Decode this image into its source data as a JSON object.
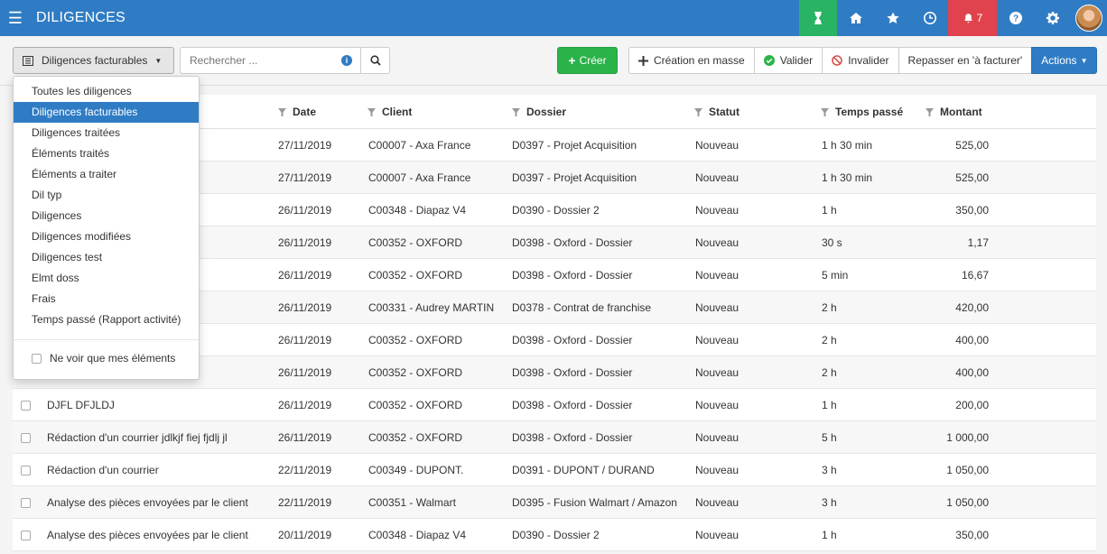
{
  "app": {
    "title": "DILIGENCES",
    "notifications_count": "7"
  },
  "toolbar": {
    "filter_label": "Diligences facturables",
    "search_placeholder": "Rechercher ...",
    "create_label": "Créer",
    "mass_create_label": "Création en masse",
    "validate_label": "Valider",
    "invalidate_label": "Invalider",
    "rebill_label": "Repasser en 'à facturer'",
    "actions_label": "Actions"
  },
  "dropdown": {
    "items": [
      "Toutes les diligences",
      "Diligences facturables",
      "Diligences traitées",
      "Éléments traités",
      "Éléments a traiter",
      "Dil typ",
      "Diligences",
      "Diligences modifiées",
      "Diligences test",
      "Elmt doss",
      "Frais",
      "Temps passé (Rapport activité)"
    ],
    "active_index": 1,
    "only_mine_label": "Ne voir que mes éléments"
  },
  "table": {
    "headers": {
      "date": "Date",
      "client": "Client",
      "dossier": "Dossier",
      "statut": "Statut",
      "temps": "Temps passé",
      "montant": "Montant"
    },
    "rows": [
      {
        "libelle": "",
        "date": "27/11/2019",
        "client": "C00007 - Axa France",
        "dossier": "D0397 - Projet Acquisition",
        "statut": "Nouveau",
        "temps": "1 h 30 min",
        "montant": "525,00"
      },
      {
        "libelle": "ar le client",
        "date": "27/11/2019",
        "client": "C00007 - Axa France",
        "dossier": "D0397 - Projet Acquisition",
        "statut": "Nouveau",
        "temps": "1 h 30 min",
        "montant": "525,00"
      },
      {
        "libelle": "",
        "date": "26/11/2019",
        "client": "C00348 - Diapaz V4",
        "dossier": "D0390 - Dossier 2",
        "statut": "Nouveau",
        "temps": "1 h",
        "montant": "350,00"
      },
      {
        "libelle": "ar le client",
        "date": "26/11/2019",
        "client": "C00352 - OXFORD",
        "dossier": "D0398 - Oxford - Dossier",
        "statut": "Nouveau",
        "temps": "30 s",
        "montant": "1,17"
      },
      {
        "libelle": "",
        "date": "26/11/2019",
        "client": "C00352 - OXFORD",
        "dossier": "D0398 - Oxford - Dossier",
        "statut": "Nouveau",
        "temps": "5 min",
        "montant": "16,67"
      },
      {
        "libelle": "ar le client",
        "date": "26/11/2019",
        "client": "C00331 - Audrey MARTIN",
        "dossier": "D0378 - Contrat de franchise",
        "statut": "Nouveau",
        "temps": "2 h",
        "montant": "420,00"
      },
      {
        "libelle": "",
        "date": "26/11/2019",
        "client": "C00352 - OXFORD",
        "dossier": "D0398 - Oxford - Dossier",
        "statut": "Nouveau",
        "temps": "2 h",
        "montant": "400,00"
      },
      {
        "libelle": "",
        "date": "26/11/2019",
        "client": "C00352 - OXFORD",
        "dossier": "D0398 - Oxford - Dossier",
        "statut": "Nouveau",
        "temps": "2 h",
        "montant": "400,00"
      },
      {
        "libelle": "DJFL DFJLDJ",
        "date": "26/11/2019",
        "client": "C00352 - OXFORD",
        "dossier": "D0398 - Oxford - Dossier",
        "statut": "Nouveau",
        "temps": "1 h",
        "montant": "200,00"
      },
      {
        "libelle": "Rédaction d'un courrier jdlkjf fiej fjdlj jl",
        "date": "26/11/2019",
        "client": "C00352 - OXFORD",
        "dossier": "D0398 - Oxford - Dossier",
        "statut": "Nouveau",
        "temps": "5 h",
        "montant": "1 000,00"
      },
      {
        "libelle": "Rédaction d'un courrier",
        "date": "22/11/2019",
        "client": "C00349 - DUPONT.",
        "dossier": "D0391 - DUPONT / DURAND",
        "statut": "Nouveau",
        "temps": "3 h",
        "montant": "1 050,00"
      },
      {
        "libelle": "Analyse des pièces envoyées par le client",
        "date": "22/11/2019",
        "client": "C00351 - Walmart",
        "dossier": "D0395 - Fusion Walmart / Amazon",
        "statut": "Nouveau",
        "temps": "3 h",
        "montant": "1 050,00"
      },
      {
        "libelle": "Analyse des pièces envoyées par le client",
        "date": "20/11/2019",
        "client": "C00348 - Diapaz V4",
        "dossier": "D0390 - Dossier 2",
        "statut": "Nouveau",
        "temps": "1 h",
        "montant": "350,00"
      }
    ]
  },
  "colors": {
    "primary": "#2f7cc4",
    "success": "#2bb34a",
    "timer": "#28b463",
    "alert": "#e1434e"
  }
}
